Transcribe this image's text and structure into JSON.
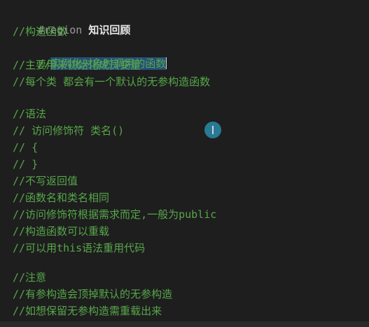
{
  "editor": {
    "region": {
      "keyword": "#region ",
      "title": "知识回顾"
    },
    "lines": [
      "//构造函数",
      "//",
      "//主要用来初始化成员变量",
      "//每个类 都会有一个默认的无参构造函数",
      "//语法",
      "// 访问修饰符 类名()",
      "// {",
      "// }",
      "//不写返回值",
      "//函数名和类名相同",
      "//访问修饰符根据需求而定,一般为public",
      "//构造函数可以重载",
      "//可以用this语法重用代码",
      "//注意",
      "//有参构造会顶掉默认的无参构造",
      "//如想保留无参构造需重载出来"
    ],
    "selected_text": "实例化对象时调用的函数"
  },
  "colors": {
    "background": "#1e1e1e",
    "comment": "#57a64a",
    "selection": "#264f78",
    "cursor": "#2a8aa8"
  }
}
